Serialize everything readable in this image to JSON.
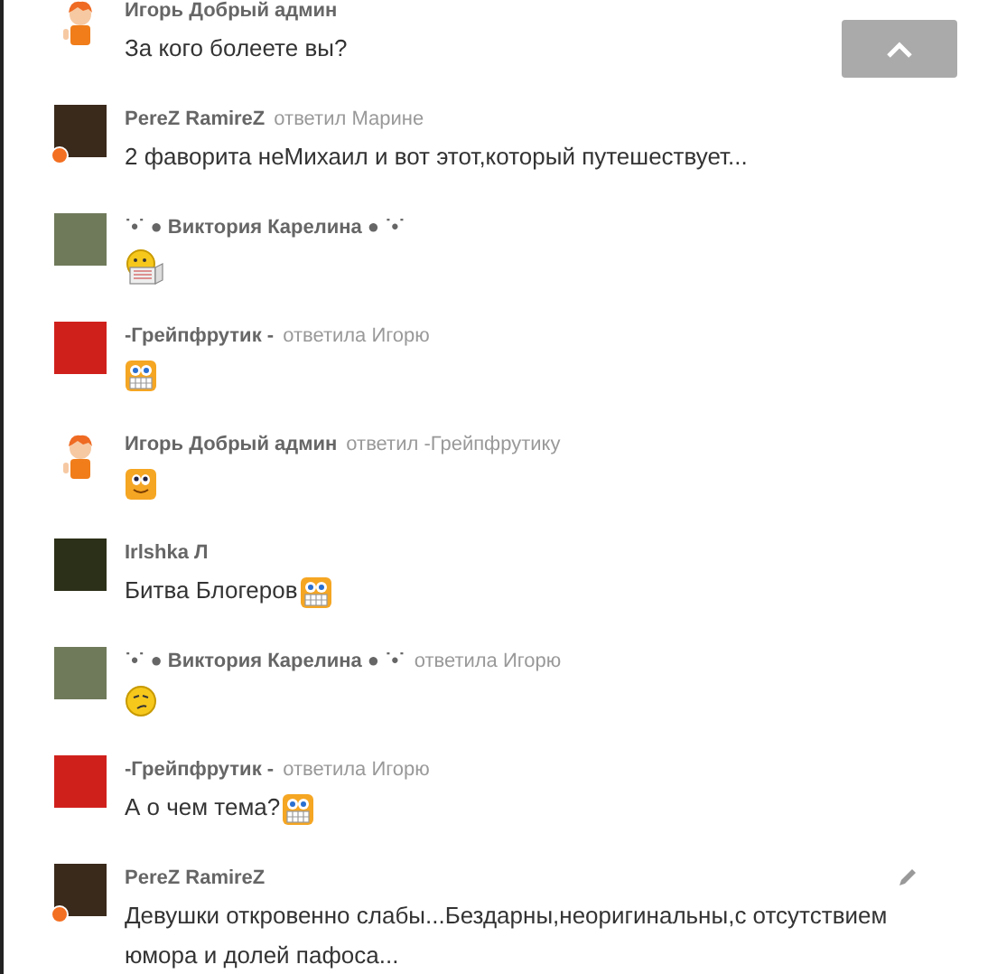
{
  "comments": [
    {
      "author": "Игорь Добрый админ",
      "avatar": {
        "kind": "cartoon"
      },
      "text": "За кого болеете вы?"
    },
    {
      "author": "PereZ RamireZ",
      "reply_to": "ответил Марине",
      "avatar": {
        "kind": "photo",
        "color": "#3a2a1c"
      },
      "online": true,
      "text": "2 фаворита неМихаил и вот этот,который путешествует..."
    },
    {
      "author": "˙•˙ ● Виктория Карелина ● ˙•˙",
      "avatar": {
        "kind": "photo",
        "color": "#6f7a5a"
      },
      "smiley": {
        "kind": "newspaper"
      }
    },
    {
      "author": "-Грейпфрутик -",
      "reply_to": "ответила Игорю",
      "avatar": {
        "kind": "photo",
        "color": "#d0201c"
      },
      "smiley": {
        "kind": "grin"
      }
    },
    {
      "author": "Игорь Добрый админ",
      "reply_to": "ответил -Грейпфрутику",
      "avatar": {
        "kind": "cartoon"
      },
      "smiley": {
        "kind": "smile"
      }
    },
    {
      "author": "Irlshka Л",
      "avatar": {
        "kind": "photo",
        "color": "#2c3018"
      },
      "text": "Битва Блогеров",
      "smiley": {
        "kind": "grin"
      }
    },
    {
      "author": "˙•˙ ● Виктория Карелина ● ˙•˙",
      "reply_to": "ответила Игорю",
      "avatar": {
        "kind": "photo",
        "color": "#6f7a5a"
      },
      "smiley": {
        "kind": "wink"
      }
    },
    {
      "author": "-Грейпфрутик -",
      "reply_to": "ответила Игорю",
      "avatar": {
        "kind": "photo",
        "color": "#d0201c"
      },
      "text": "А о чем тема?",
      "smiley": {
        "kind": "grin"
      }
    },
    {
      "author": "PereZ RamireZ",
      "avatar": {
        "kind": "photo",
        "color": "#3a2a1c"
      },
      "online": true,
      "editable": true,
      "text": "Девушки откровенно слабы...Бездарны,неоригинальны,с отсутствием юмора и долей пафоса..."
    }
  ]
}
